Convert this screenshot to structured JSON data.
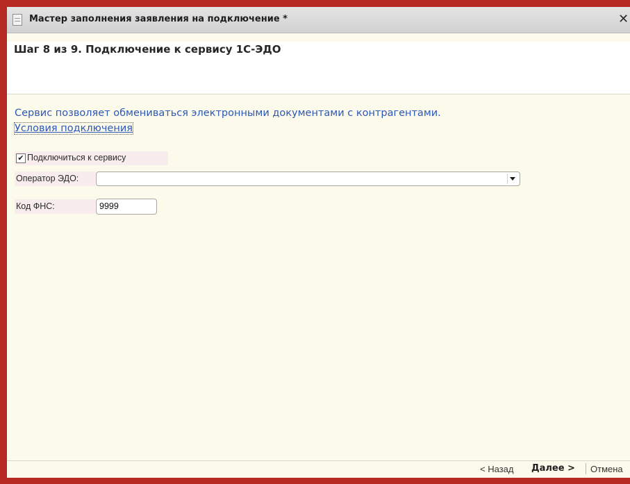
{
  "window": {
    "title": "Мастер заполнения заявления на подключение *",
    "close_glyph": "✕",
    "icon": "document-icon"
  },
  "header": {
    "step_title": "Шаг 8 из 9. Подключение к сервису 1С-ЭДО"
  },
  "main": {
    "description": "Сервис позволяет обмениваться электронными документами с контрагентами.",
    "conditions_link": "Условия подключения",
    "connect_checkbox": {
      "label": "Подключиться к сервису",
      "checked": true,
      "check_glyph": "✔"
    },
    "operator": {
      "label": "Оператор ЭДО:",
      "value": ""
    },
    "fns_code": {
      "label": "Код ФНС:",
      "value": "9999"
    }
  },
  "footer": {
    "back_label": "< Назад",
    "next_label": "Далее >",
    "cancel_label": "Отмена"
  },
  "colors": {
    "window_border": "#b42a22",
    "background": "#fbfaeb",
    "link_blue": "#2d58b8",
    "label_highlight": "#f8ecec"
  }
}
